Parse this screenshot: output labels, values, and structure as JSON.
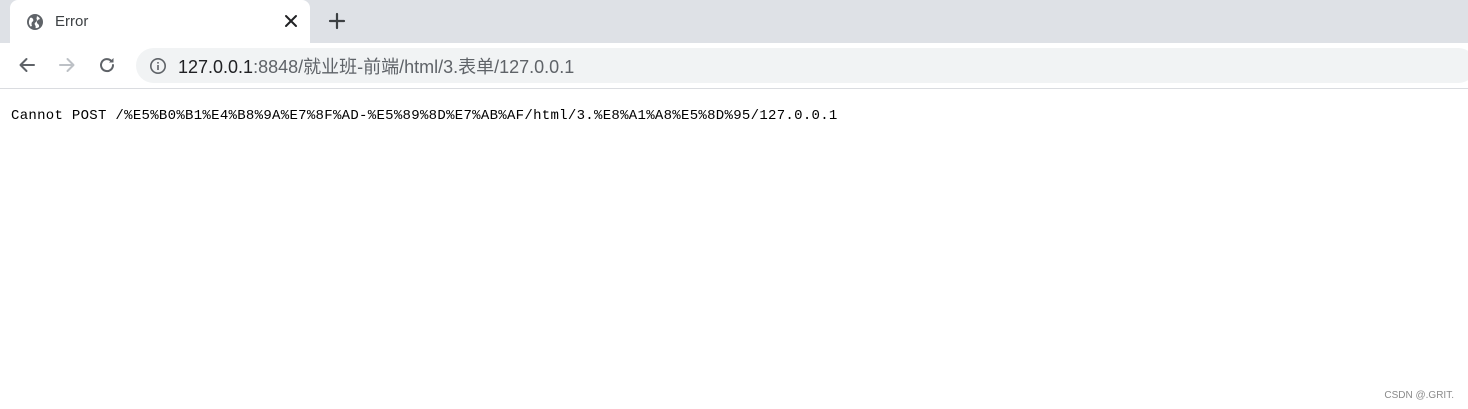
{
  "tab": {
    "title": "Error",
    "favicon": "globe-icon",
    "close_icon": "close-icon"
  },
  "new_tab_icon": "plus-icon",
  "toolbar": {
    "back_icon": "arrow-left-icon",
    "forward_icon": "arrow-right-icon",
    "reload_icon": "reload-icon",
    "info_icon": "info-icon"
  },
  "address_bar": {
    "host": "127.0.0.1",
    "path": ":8848/就业班-前端/html/3.表单/127.0.0.1"
  },
  "page": {
    "error_message": "Cannot POST /%E5%B0%B1%E4%B8%9A%E7%8F%AD-%E5%89%8D%E7%AB%AF/html/3.%E8%A1%A8%E5%8D%95/127.0.0.1"
  },
  "watermark": "CSDN @.GRIT.",
  "colors": {
    "tabstrip": "#dee1e6",
    "omnibox": "#f1f3f4",
    "icon": "#5f6368",
    "forward_disabled": "#bdc1c6"
  }
}
